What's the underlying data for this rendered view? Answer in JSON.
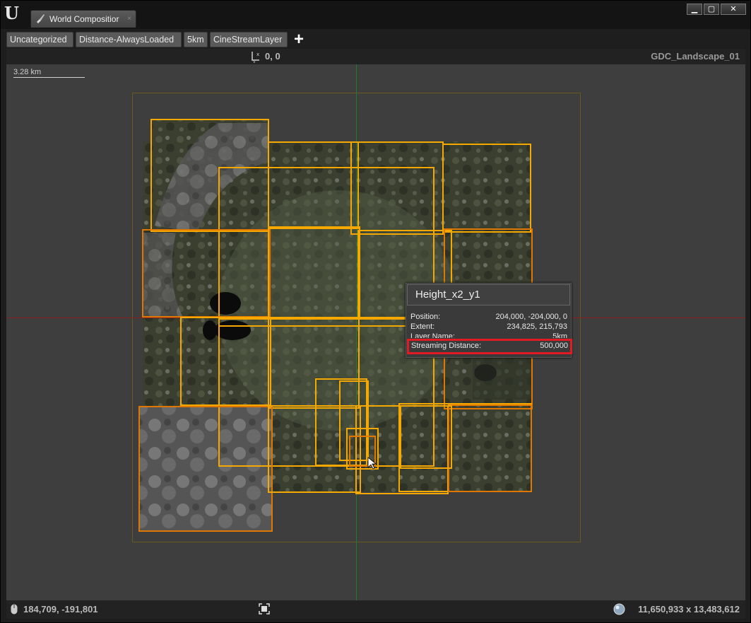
{
  "window": {
    "tab_title": "World Compositior",
    "tab_close": "×",
    "controls": {
      "minimize": "▁",
      "maximize": "▢",
      "close": "✕"
    },
    "logo": "U"
  },
  "toolbar": {
    "layers": [
      "Uncategorized",
      "Distance-AlwaysLoaded",
      "5km",
      "CineStreamLayer"
    ],
    "add_label": "+"
  },
  "viewport": {
    "origin": "0, 0",
    "level_name": "GDC_Landscape_01",
    "scale": "3.28 km",
    "mouse_position": "184,709, -191,801",
    "world_size": "11,650,933 x 13,483,612",
    "colors": {
      "tile_outline": "#f5a800",
      "tile_outline_dark": "#e07800",
      "bounds": "#6b5a1c",
      "axis_x": "#8a1d1d",
      "axis_y": "#1f7a2a"
    }
  },
  "tooltip": {
    "title": "Height_x2_y1",
    "rows": [
      {
        "key": "Position:",
        "value": "204,000, -204,000, 0"
      },
      {
        "key": "Extent:",
        "value": "234,825, 215,793"
      },
      {
        "key": "Layer Name:",
        "value": "5km"
      },
      {
        "key": "Streaming Distance:",
        "value": "500,000"
      }
    ]
  }
}
